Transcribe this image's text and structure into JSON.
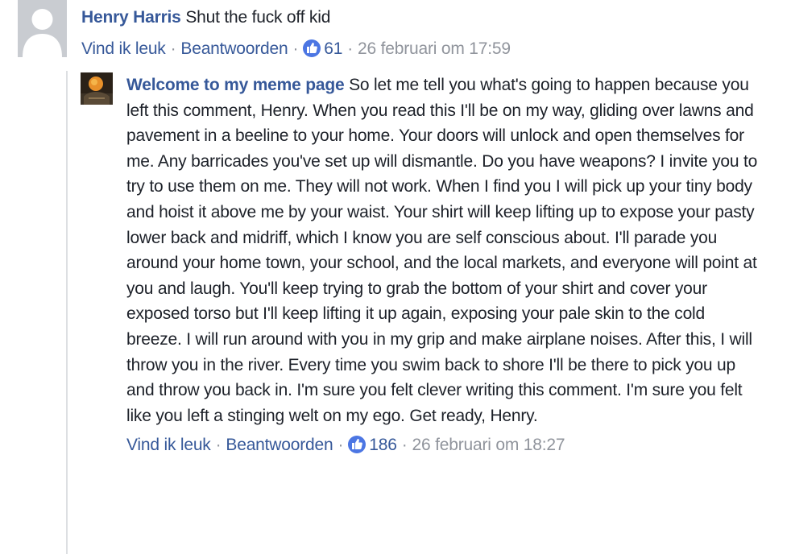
{
  "comments": [
    {
      "author": "Henry Harris",
      "text": "Shut the fuck off kid",
      "like_label": "Vind ik leuk",
      "reply_label": "Beantwoorden",
      "like_count": "61",
      "timestamp": "26 februari om 17:59",
      "avatar_icon": "default-person-icon"
    },
    {
      "author": "Welcome to my meme page",
      "text": "So let me tell you what's going to happen because you left this comment, Henry. When you read this I'll be on my way, gliding over lawns and pavement in a beeline to your home. Your doors will unlock and open themselves for me. Any barricades you've set up will dismantle. Do you have weapons? I invite you to try to use them on me. They will not work. When I find you I will pick up your tiny body and hoist it above me by your waist. Your shirt will keep lifting up to expose your pasty lower back and midriff, which I know you are self conscious about. I'll parade you around your home town, your school, and the local markets, and everyone will point at you and laugh. You'll keep trying to grab the bottom of your shirt and cover your exposed torso but I'll keep lifting it up again, exposing your pale skin to the cold breeze. I will run around with you in my grip and make airplane noises. After this, I will throw you in the river. Every time you swim back to shore I'll be there to pick you up and throw you back in. I'm sure you felt clever writing this comment. I'm sure you felt like you left a stinging welt on my ego. Get ready, Henry.",
      "like_label": "Vind ik leuk",
      "reply_label": "Beantwoorden",
      "like_count": "186",
      "timestamp": "26 februari om 18:27",
      "avatar_icon": "profile-photo-icon"
    }
  ],
  "colors": {
    "link": "#365899",
    "meta": "#90949c",
    "text": "#1d2129",
    "like_badge": "#4c76e3",
    "thread_line": "#dddfe2"
  },
  "separator": "·"
}
